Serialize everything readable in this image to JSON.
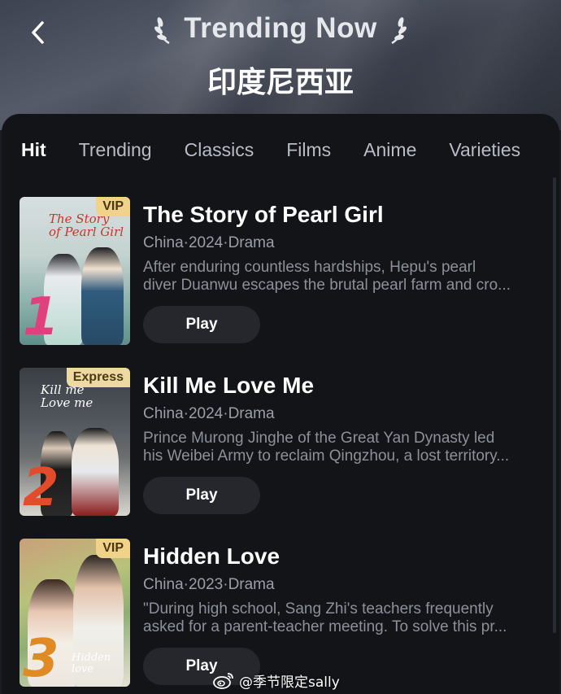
{
  "header": {
    "title": "Trending Now",
    "region": "印度尼西亚"
  },
  "tabs": [
    {
      "label": "Hit",
      "active": true
    },
    {
      "label": "Trending",
      "active": false
    },
    {
      "label": "Classics",
      "active": false
    },
    {
      "label": "Films",
      "active": false
    },
    {
      "label": "Anime",
      "active": false
    },
    {
      "label": "Varieties",
      "active": false
    }
  ],
  "items": [
    {
      "rank": "1",
      "badge": "VIP",
      "poster_title_line1": "The Story",
      "poster_title_line2": "of Pearl Girl",
      "title": "The Story of Pearl Girl",
      "meta": "China·2024·Drama",
      "desc_line1": "After enduring countless hardships, Hepu's pearl",
      "desc_line2": "diver Duanwu escapes the brutal pearl farm and cro...",
      "play_label": "Play",
      "rank_color": "#e0417e"
    },
    {
      "rank": "2",
      "badge": "Express",
      "poster_title_line1": "Kill me",
      "poster_title_line2": "Love me",
      "title": "Kill Me Love Me",
      "meta": "China·2024·Drama",
      "desc_line1": "Prince Murong Jinghe of the Great Yan Dynasty led",
      "desc_line2": "his Weibei Army to reclaim Qingzhou, a lost territory...",
      "play_label": "Play",
      "rank_color": "#e24b2b"
    },
    {
      "rank": "3",
      "badge": "VIP",
      "poster_title_line1": "Hidden love",
      "poster_title_line2": "",
      "title": "Hidden Love",
      "meta": "China·2023·Drama",
      "desc_line1": "\"During high school, Sang Zhi's teachers frequently",
      "desc_line2": "asked for a parent-teacher meeting. To solve this pr...",
      "play_label": "Play",
      "rank_color": "#e08a24"
    }
  ],
  "watermark": "@季节限定sally",
  "colors": {
    "background": "#131418",
    "vip_badge": "#f0d28a",
    "play_button": "#25272d"
  }
}
